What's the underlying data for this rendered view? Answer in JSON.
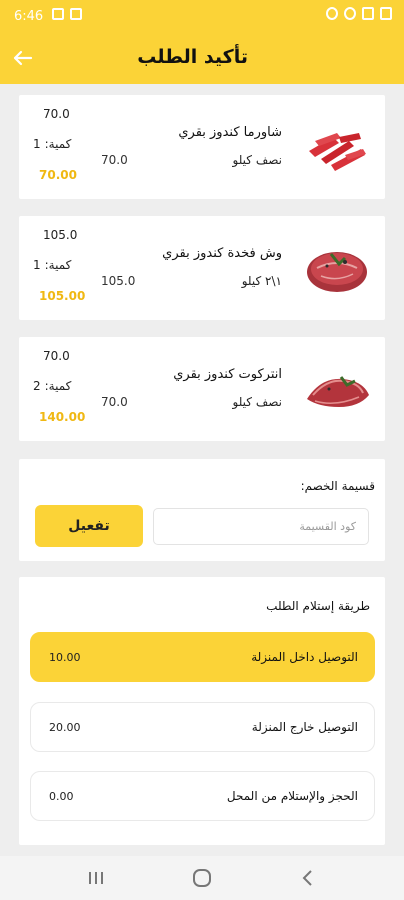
{
  "status_bar": {
    "time": "6:46"
  },
  "header": {
    "title": "تأكيد الطلب",
    "back_icon": "arrow-left-icon"
  },
  "products": [
    {
      "name": "شاورما كندوز بقري",
      "unit": "نصف كيلو",
      "unit_price": "70.0",
      "price": "70.0",
      "qty_label": "كمية:",
      "qty": "1",
      "total": "70.00",
      "image": "meat-strips-image"
    },
    {
      "name": "وش فخدة كندوز بقري",
      "unit": "١\\٢ كيلو",
      "unit_price": "105.0",
      "price": "105.0",
      "qty_label": "كمية:",
      "qty": "1",
      "total": "105.00",
      "image": "steak-image"
    },
    {
      "name": "انتركوت كندوز بقري",
      "unit": "نصف كيلو",
      "unit_price": "70.0",
      "price": "70.0",
      "qty_label": "كمية:",
      "qty": "2",
      "total": "140.00",
      "image": "meat-slices-image"
    }
  ],
  "coupon": {
    "label": "قسيمة الخصم:",
    "placeholder": "كود القسيمة",
    "button": "تفعيل"
  },
  "delivery": {
    "heading": "طريقة إستلام الطلب",
    "options": [
      {
        "name": "التوصيل داخل المنزلة",
        "price": "10.00",
        "selected": true
      },
      {
        "name": "التوصيل خارج المنزلة",
        "price": "20.00",
        "selected": false
      },
      {
        "name": "الحجز والإستلام من المحل",
        "price": "0.00",
        "selected": false
      }
    ]
  },
  "colors": {
    "accent": "#fbd337",
    "total": "#f0b813"
  }
}
